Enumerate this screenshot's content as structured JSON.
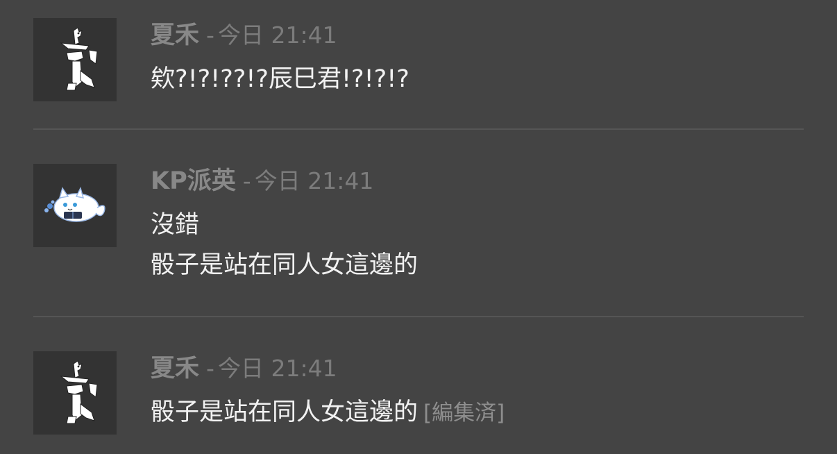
{
  "messages": [
    {
      "author": "夏禾",
      "separator": "-",
      "timestamp": "今日 21:41",
      "avatar": "dragon-avatar-icon",
      "lines": [
        "欸?!?!??!?辰巳君!?!?!?"
      ]
    },
    {
      "author": "KP派英",
      "separator": "-",
      "timestamp": "今日 21:41",
      "avatar": "cat-avatar-icon",
      "lines": [
        "沒錯",
        "骰子是站在同人女這邊的"
      ]
    },
    {
      "author": "夏禾",
      "separator": "-",
      "timestamp": "今日 21:41",
      "avatar": "dragon-avatar-icon",
      "lines": [
        "骰子是站在同人女這邊的"
      ],
      "edited_label": "[編集済]"
    }
  ],
  "colors": {
    "background": "#444444",
    "avatar_bg": "#333333",
    "author": "#888888",
    "timestamp": "#7c7c7c",
    "text": "#f2f2f2",
    "divider": "#555555"
  }
}
